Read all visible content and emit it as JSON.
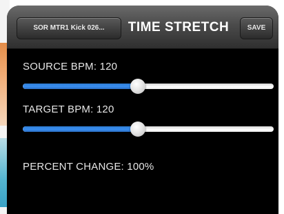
{
  "nav": {
    "back_label": "SOR MTR1 Kick 026...",
    "title": "TIME STRETCH",
    "save_label": "SAVE"
  },
  "source": {
    "label": "SOURCE BPM: 120",
    "slider_level": 0.46
  },
  "target": {
    "label": "TARGET BPM: 120",
    "slider_level": 0.46
  },
  "percent": {
    "label": "PERCENT CHANGE: 100%"
  },
  "colors": {
    "accent": "#3a8ef0",
    "background": "#000000",
    "text": "#e6e6e6"
  }
}
